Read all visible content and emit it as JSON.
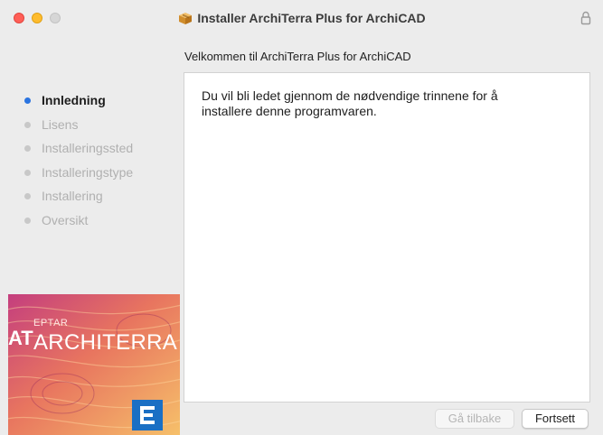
{
  "window": {
    "title": "Installer ArchiTerra Plus for ArchiCAD",
    "subtitle": "Velkommen til ArchiTerra Plus for ArchiCAD",
    "icons": {
      "app": "installer-box-icon",
      "lock": "lock-icon"
    }
  },
  "sidebar": {
    "steps": [
      {
        "label": "Innledning",
        "active": true
      },
      {
        "label": "Lisens",
        "active": false
      },
      {
        "label": "Installeringssted",
        "active": false
      },
      {
        "label": "Installeringstype",
        "active": false
      },
      {
        "label": "Installering",
        "active": false
      },
      {
        "label": "Oversikt",
        "active": false
      }
    ],
    "brand": {
      "small": "EPTAR",
      "big": "ARCHITERRA",
      "mark": "AT"
    }
  },
  "content": {
    "intro": "Du vil bli ledet gjennom de nødvendige trinnene for å installere denne programvaren."
  },
  "buttons": {
    "back": "Gå tilbake",
    "next": "Fortsett"
  },
  "colors": {
    "active_dot": "#2a74e0",
    "inactive_text": "#b0b0b0",
    "badge": "#1a6fc4"
  }
}
